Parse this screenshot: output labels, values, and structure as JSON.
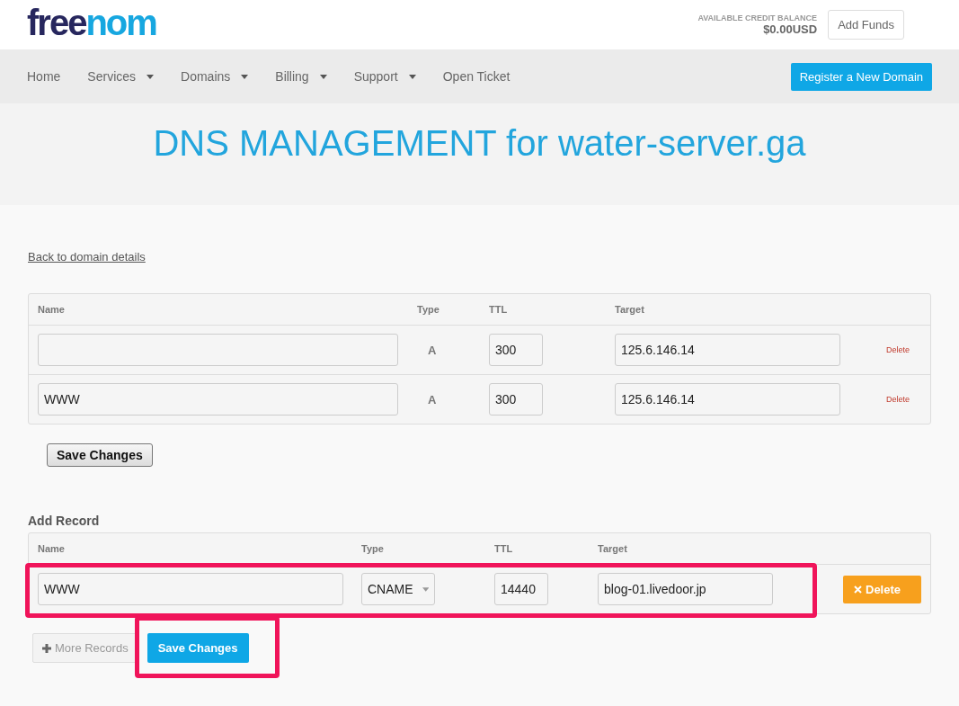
{
  "header": {
    "logo": {
      "first": "free",
      "second": "nom"
    },
    "credit_label": "AVAILABLE CREDIT BALANCE",
    "credit_value": "$0.00USD",
    "add_funds": "Add Funds"
  },
  "nav": {
    "items": [
      {
        "label": "Home",
        "dropdown": false
      },
      {
        "label": "Services",
        "dropdown": true
      },
      {
        "label": "Domains",
        "dropdown": true
      },
      {
        "label": "Billing",
        "dropdown": true
      },
      {
        "label": "Support",
        "dropdown": true
      },
      {
        "label": "Open Ticket",
        "dropdown": false
      }
    ],
    "cta": "Register a New Domain"
  },
  "title": "DNS MANAGEMENT for water-server.ga",
  "back_link": "Back to domain details",
  "records": {
    "columns": [
      "Name",
      "Type",
      "TTL",
      "Target"
    ],
    "rows": [
      {
        "name": "",
        "type": "A",
        "ttl": "300",
        "target": "125.6.146.14",
        "delete": "Delete"
      },
      {
        "name": "WWW",
        "type": "A",
        "ttl": "300",
        "target": "125.6.146.14",
        "delete": "Delete"
      }
    ],
    "save": "Save Changes"
  },
  "add_record": {
    "heading": "Add Record",
    "columns": [
      "Name",
      "Type",
      "TTL",
      "Target"
    ],
    "row": {
      "name": "WWW",
      "type": "CNAME",
      "ttl": "14440",
      "target": "blog-01.livedoor.jp",
      "delete": "Delete"
    },
    "more": "More Records",
    "save": "Save Changes"
  }
}
